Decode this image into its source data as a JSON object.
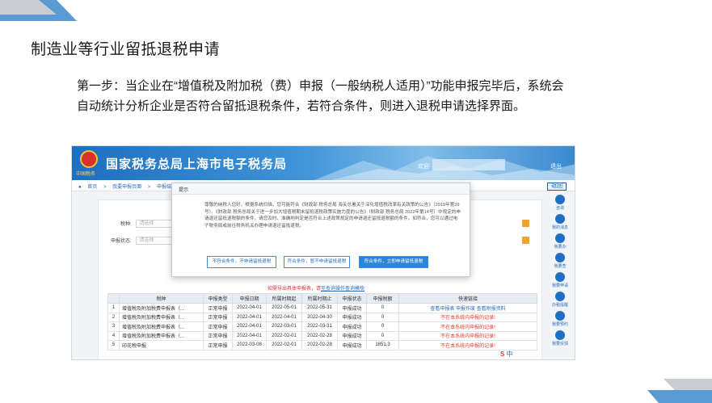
{
  "slide": {
    "title": "制造业等行业留抵退税申请",
    "body": "第一步：当企业在“增值税及附加税（费）申报（一般纳税人适用）”功能申报完毕后，系统会自动统计分析企业是否符合留抵退税条件，若符合条件，则进入退税申请选择界面。"
  },
  "colors": {
    "deco_gray": "#c9ccd1",
    "deco_blue": "#5b9bd5",
    "banner_blue": "#1d6fc0",
    "primary_button": "#2b86d9",
    "warning_red": "#e23a2e"
  },
  "portal": {
    "site_title": "国家税务总局上海市电子税务局",
    "emblem_caption": "中国税务",
    "welcome": "欢迎",
    "logout": "退出",
    "breadcrumb": [
      "首页",
      "我要申报页面",
      "申报结果"
    ],
    "return_label": "返回"
  },
  "form": {
    "tax_label": "税种:",
    "tax_placeholder": "请选择",
    "status_label": "申报状态:",
    "status_placeholder": "请选择"
  },
  "notice": {
    "text": "如需导出具体申报表，请",
    "link": "至查询操作查询模块"
  },
  "table": {
    "headers": [
      "",
      "税种",
      "申报类型",
      "申报日期",
      "所属时期起",
      "所属时期止",
      "申报状态",
      "申报税额",
      "快速链接"
    ],
    "rows": [
      [
        "1",
        "增值税及附加税费申报表（...",
        "正常申报",
        "2022-04-01",
        "2022-05-01",
        "2022-05-31",
        "申报成功",
        "0",
        "查看申报表  申报作废  查看附报资料"
      ],
      [
        "2",
        "增值税及附加税费申报表（...",
        "正常申报",
        "2022-04-01",
        "2022-04-01",
        "2022-04-30",
        "申报成功",
        "0",
        "不在本系统内申报的记录!"
      ],
      [
        "3",
        "增值税及附加税费申报表（...",
        "正常申报",
        "2022-04-01",
        "2022-03-01",
        "2022-03-31",
        "申报成功",
        "0",
        "不在本系统内申报的记录!"
      ],
      [
        "4",
        "增值税及附加税费申报表（...",
        "正常申报",
        "2022-04-01",
        "2022-02-01",
        "2022-02-28",
        "申报成功",
        "0",
        "不在本系统内申报的记录!"
      ],
      [
        "5",
        "印花税申报",
        "正常申报",
        "2022-03-08",
        "2022-02-01",
        "2022-02-28",
        "申报成功",
        "1851.3",
        "不在本系统内申报的记录!"
      ]
    ]
  },
  "modal": {
    "title": "提示",
    "message": "尊敬的纳税人您好，根据系统扫描，您可能符合《财政部 税务总局 海关总署关于深化增值税改革有关政策的公告》（2019年第39号）、《财政部 税务总局关于进一步加大增值税期末留抵退税政策实施力度的公告》（财政部 税务总局 2022年第14号）中规定的申请退还留抵退税额的条件，请您及时、准确地判定是否符合上述政策规定的申请退还留抵退税额的条件。如符合，您可以通过电子税务局或前往税务机关办理申请退还留抵退税。",
    "buttons": [
      "不符合条件，不申请留抵退税",
      "符合条件，暂不申请留抵退税",
      "符合条件，立即申请留抵退税"
    ]
  },
  "side_toolbar": [
    "咨询",
    "我的消息",
    "我要办",
    "我要查",
    "我要申请",
    "办税提醒",
    "我要预约",
    "我要反馈"
  ],
  "ime": {
    "logo": "S",
    "label": "中"
  }
}
